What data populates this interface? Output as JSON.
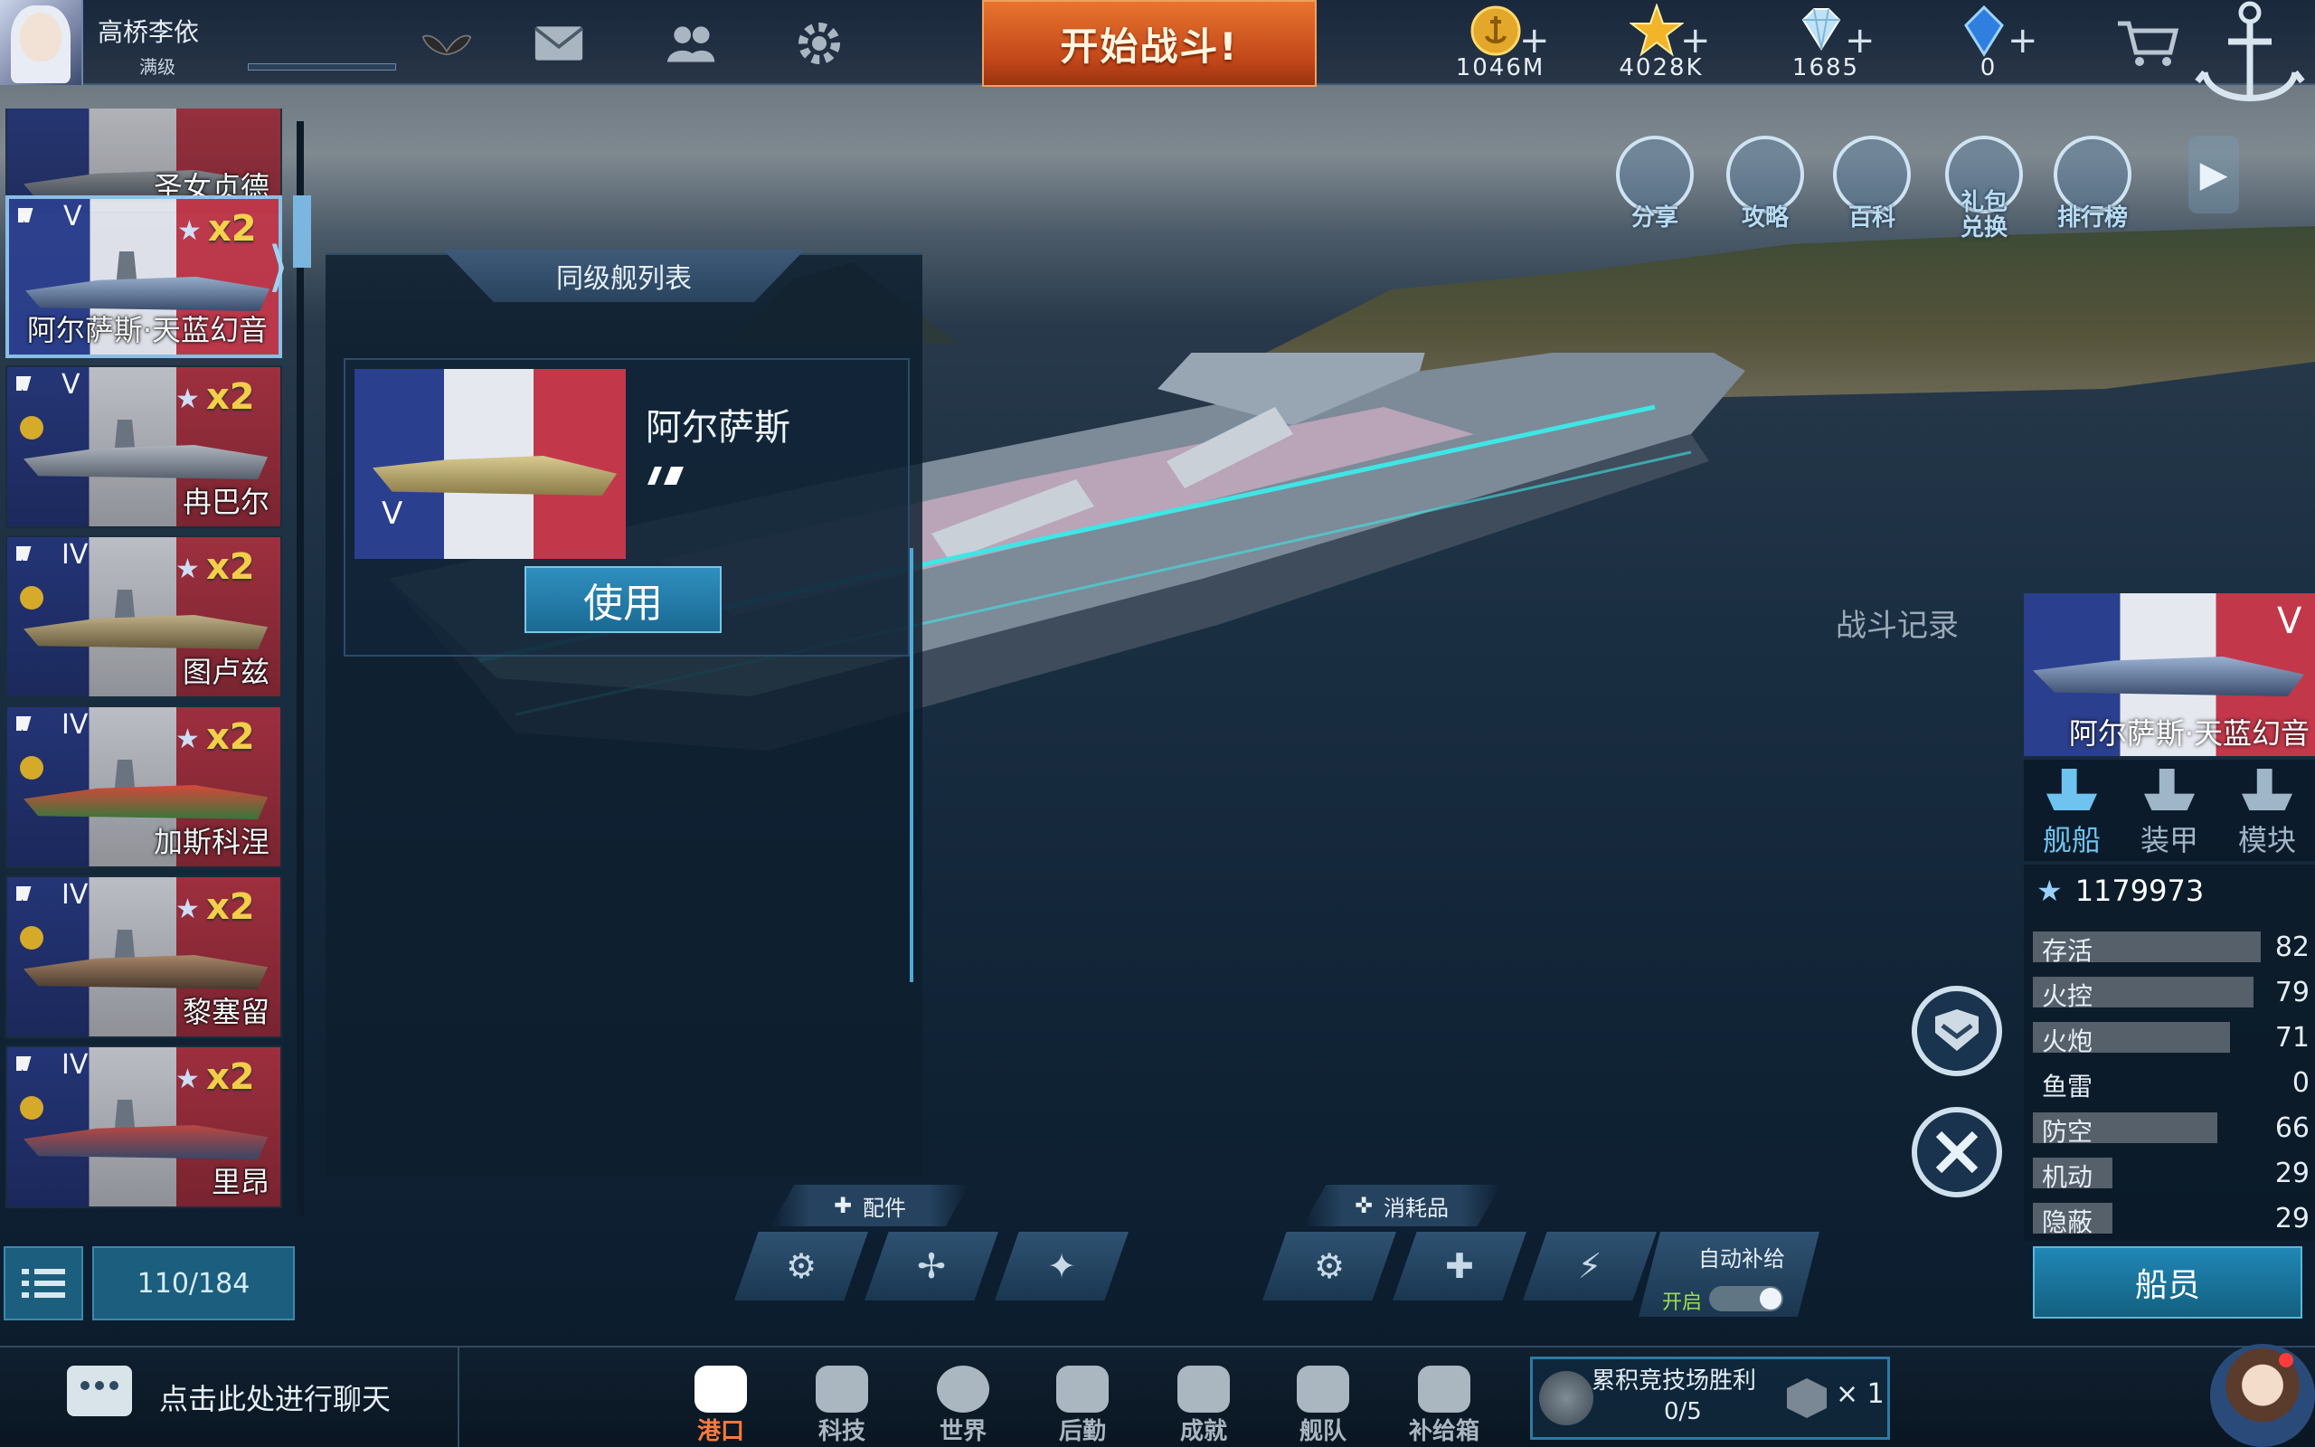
{
  "player": {
    "name": "高桥李依",
    "level_label": "满级"
  },
  "top_bar": {
    "start_battle": "开始战斗!",
    "resources": [
      {
        "icon": "gold-anchor-icon",
        "value": "1046M"
      },
      {
        "icon": "star-merit-icon",
        "value": "4028K"
      },
      {
        "icon": "diamond-icon",
        "value": "1685"
      },
      {
        "icon": "blue-crystal-icon",
        "value": "0"
      }
    ],
    "plus": "+",
    "icons": [
      "wings-icon",
      "mail-icon",
      "friends-icon",
      "settings-gear-icon",
      "shop-cart-icon",
      "anchor-logo-icon"
    ]
  },
  "shortcuts": [
    {
      "label": "分享",
      "icon": "share-icon"
    },
    {
      "label": "攻略",
      "icon": "guide-house-icon"
    },
    {
      "label": "百科",
      "icon": "wiki-question-icon"
    },
    {
      "label": "礼包兑换",
      "icon": "gift-exchange-icon"
    },
    {
      "label": "排行榜",
      "icon": "leaderboard-icon"
    }
  ],
  "ship_list": {
    "items": [
      {
        "name": "圣女贞德",
        "tier": "",
        "mult": "",
        "selected": false
      },
      {
        "name": "阿尔萨斯·天蓝幻音",
        "tier": "V",
        "mult": "x2",
        "selected": true
      },
      {
        "name": "冉巴尔",
        "tier": "V",
        "mult": "x2",
        "selected": false
      },
      {
        "name": "图卢兹",
        "tier": "IV",
        "mult": "x2",
        "selected": false
      },
      {
        "name": "加斯科涅",
        "tier": "IV",
        "mult": "x2",
        "selected": false
      },
      {
        "name": "黎塞留",
        "tier": "IV",
        "mult": "x2",
        "selected": false
      },
      {
        "name": "里昂",
        "tier": "IV",
        "mult": "x2",
        "selected": false
      }
    ],
    "count": "110/184"
  },
  "tier_panel": {
    "title": "同级舰列表",
    "ship_name": "阿尔萨斯",
    "tier": "V",
    "use_label": "使用"
  },
  "battle_record": "战斗记录",
  "ship_detail": {
    "tier": "V",
    "name": "阿尔萨斯·天蓝幻音",
    "tabs": [
      {
        "label": "舰船",
        "active": true
      },
      {
        "label": "装甲",
        "active": false
      },
      {
        "label": "模块",
        "active": false
      }
    ],
    "power": "1179973",
    "stats": [
      {
        "name": "存活",
        "value": "82"
      },
      {
        "name": "火控",
        "value": "79"
      },
      {
        "name": "火炮",
        "value": "71"
      },
      {
        "name": "鱼雷",
        "value": "0"
      },
      {
        "name": "防空",
        "value": "66"
      },
      {
        "name": "机动",
        "value": "29"
      },
      {
        "name": "隐蔽",
        "value": "29"
      }
    ],
    "crew_label": "船员"
  },
  "equipment": {
    "parts_label": "配件",
    "consumables_label": "消耗品",
    "auto_supply_label": "自动补给",
    "auto_supply_state": "开启"
  },
  "chat": {
    "placeholder": "点击此处进行聊天"
  },
  "nav": [
    {
      "label": "港口",
      "icon": "port-icon",
      "active": true
    },
    {
      "label": "科技",
      "icon": "tech-icon",
      "active": false
    },
    {
      "label": "世界",
      "icon": "world-globe-icon",
      "active": false
    },
    {
      "label": "后勤",
      "icon": "logistics-icon",
      "active": false
    },
    {
      "label": "成就",
      "icon": "achievement-icon",
      "active": false
    },
    {
      "label": "舰队",
      "icon": "fleet-icon",
      "active": false
    },
    {
      "label": "补给箱",
      "icon": "supply-box-icon",
      "active": false
    }
  ],
  "arena": {
    "title": "累积竞技场胜利",
    "progress": "0/5",
    "reward_mult": "× 1"
  },
  "colors": {
    "accent": "#1b6e96",
    "start_button": "#d85a24",
    "active_nav": "#ff7a3d"
  }
}
